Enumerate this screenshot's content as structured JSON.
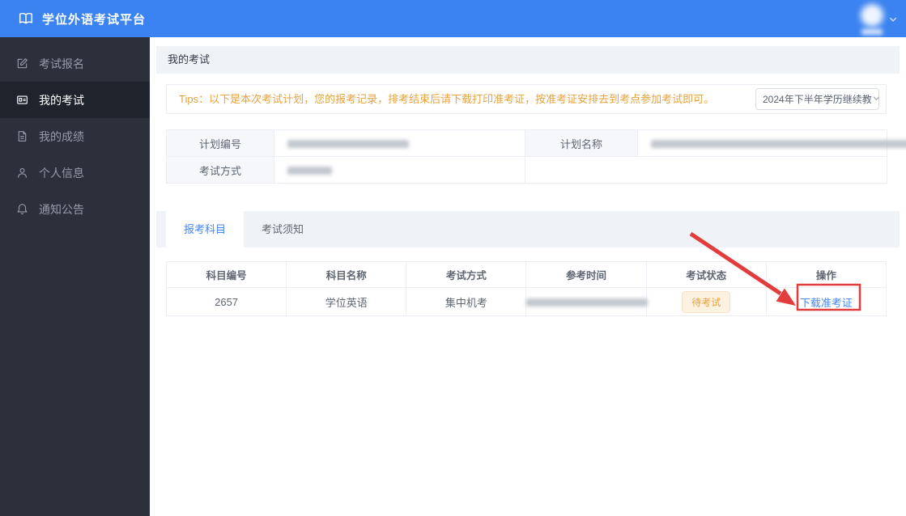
{
  "app": {
    "title": "学位外语考试平台"
  },
  "topbar": {
    "user": {
      "avatar_redacted": true,
      "name_redacted": true
    }
  },
  "sidebar": {
    "items": [
      {
        "label": "考试报名",
        "icon": "edit-icon",
        "active": false
      },
      {
        "label": "我的考试",
        "icon": "exam-card-icon",
        "active": true
      },
      {
        "label": "我的成绩",
        "icon": "score-document-icon",
        "active": false
      },
      {
        "label": "个人信息",
        "icon": "person-icon",
        "active": false
      },
      {
        "label": "通知公告",
        "icon": "bell-icon",
        "active": false
      }
    ]
  },
  "page": {
    "title": "我的考试"
  },
  "tips": {
    "text": "Tips：以下是本次考试计划，您的报考记录，排考结束后请下载打印准考证，按准考证安排去到考点参加考试即可。",
    "term_select": {
      "value": "2024年下半年学历继续教",
      "truncated": true
    }
  },
  "plan_info": {
    "plan_no_label": "计划编号",
    "plan_no_redacted": true,
    "plan_name_label": "计划名称",
    "plan_name_redacted": true,
    "exam_mode_label": "考试方式",
    "exam_mode_redacted": true
  },
  "tabs": {
    "items": [
      {
        "label": "报考科目",
        "active": true
      },
      {
        "label": "考试须知",
        "active": false
      }
    ]
  },
  "subjects_table": {
    "columns": [
      "科目编号",
      "科目名称",
      "考试方式",
      "参考时间",
      "考试状态",
      "操作"
    ],
    "rows": [
      {
        "code": "2657",
        "name": "学位英语",
        "mode": "集中机考",
        "time_redacted": true,
        "status": "待考试",
        "action_label": "下载准考证"
      }
    ]
  },
  "annotation": {
    "shape": "red-arrow-and-box",
    "target": "下载准考证",
    "color": "#e23c3c"
  },
  "colors": {
    "topbar_blue": "#3b83f0",
    "sidebar_dark": "#2b303a",
    "sidebar_active": "#1f242c",
    "section_gray": "#eff2f7",
    "tip_orange": "#e6a23c",
    "link_blue": "#4585f4",
    "badge_bg": "#fdf1e1",
    "annotation_red": "#e23c3c"
  }
}
